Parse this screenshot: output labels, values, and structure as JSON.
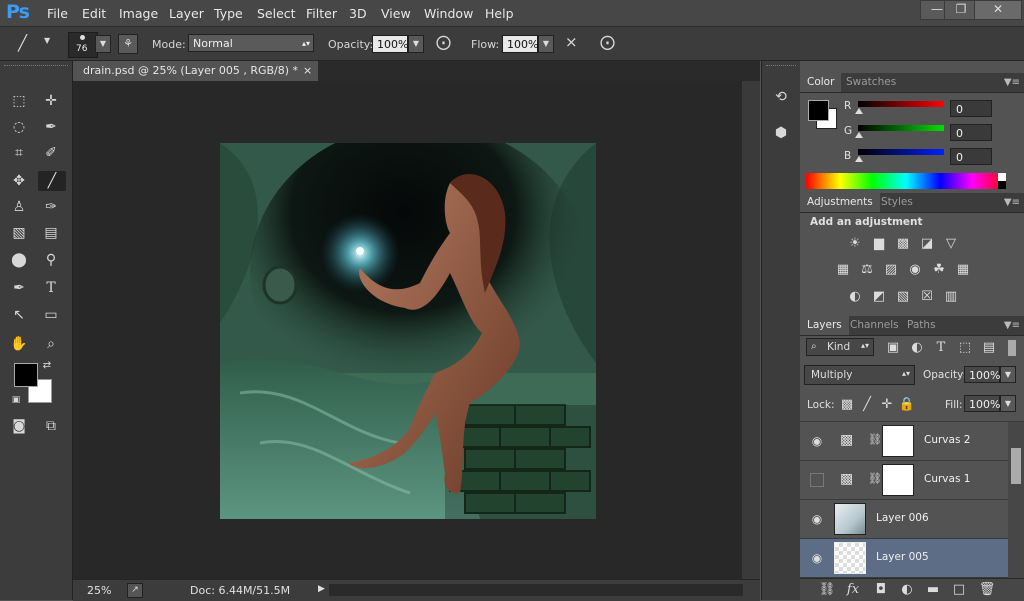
{
  "app": {
    "logo": "Ps"
  },
  "menu": [
    "File",
    "Edit",
    "Image",
    "Layer",
    "Type",
    "Select",
    "Filter",
    "3D",
    "View",
    "Window",
    "Help"
  ],
  "window_controls": {
    "minimize": "—",
    "restore": "❐",
    "close": "✕"
  },
  "options": {
    "brush_size": "76",
    "mode_label": "Mode:",
    "mode_value": "Normal",
    "opacity_label": "Opacity:",
    "opacity_value": "100%",
    "flow_label": "Flow:",
    "flow_value": "100%"
  },
  "document": {
    "tab_title": "drain.psd @ 25% (Layer 005      , RGB/8) *",
    "close": "×",
    "zoom": "25%",
    "doc_info": "Doc: 6.44M/51.5M"
  },
  "color_panel": {
    "tabs": [
      "Color",
      "Swatches"
    ],
    "r_label": "R",
    "r_value": "0",
    "g_label": "G",
    "g_value": "0",
    "b_label": "B",
    "b_value": "0",
    "foreground": "#000000",
    "background": "#ffffff"
  },
  "adjustments_panel": {
    "tabs": [
      "Adjustments",
      "Styles"
    ],
    "heading": "Add an adjustment",
    "icons": [
      "brightness-icon",
      "levels-icon",
      "curves-icon",
      "exposure-icon",
      "vibrance-icon",
      "hue-saturation-icon",
      "color-balance-icon",
      "black-white-icon",
      "photo-filter-icon",
      "channel-mixer-icon",
      "color-lookup-icon",
      "invert-icon",
      "posterize-icon",
      "threshold-icon",
      "selective-color-icon",
      "gradient-map-icon"
    ]
  },
  "layers_panel": {
    "tabs": [
      "Layers",
      "Channels",
      "Paths"
    ],
    "kind_label": "Kind",
    "blend_mode": "Multiply",
    "opacity_label": "Opacity:",
    "opacity_value": "100%",
    "lock_label": "Lock:",
    "fill_label": "Fill:",
    "fill_value": "100%",
    "layers": [
      {
        "name": "Curvas 2",
        "visible": true,
        "type": "adjustment"
      },
      {
        "name": "Curvas 1",
        "visible": false,
        "type": "adjustment"
      },
      {
        "name": "Layer 006",
        "visible": true,
        "type": "pixel"
      },
      {
        "name": "Layer 005",
        "visible": true,
        "type": "pixel",
        "selected": true
      }
    ]
  }
}
